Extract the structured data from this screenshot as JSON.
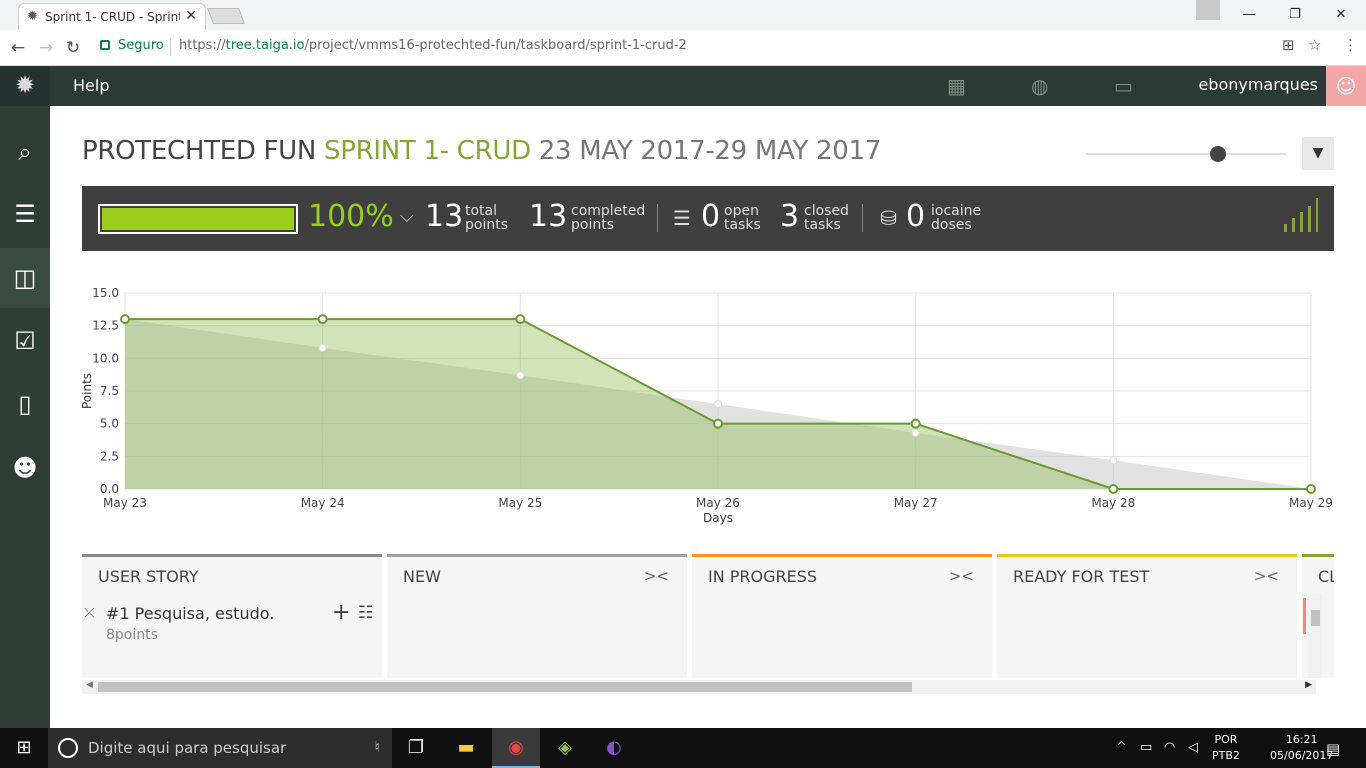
{
  "browser": {
    "tab_title": "Sprint 1- CRUD - Sprint t",
    "tab_close": "✕",
    "window_controls": [
      "—",
      "❐",
      "✕"
    ],
    "secure_label": "Seguro",
    "url_scheme": "https://",
    "url_host": "tree.taiga.io",
    "url_path": "/project/vmms16-protechted-fun/taskboard/sprint-1-crud-2"
  },
  "topnav": {
    "help_label": "Help",
    "username": "ebonymarques"
  },
  "heading": {
    "project": "PROTECHTED FUN",
    "sprint": "SPRINT 1- CRUD",
    "dates": "23 MAY 2017-29 MAY 2017"
  },
  "stats": {
    "progress_percent": 100,
    "percent_label": "100%",
    "total_points": "13",
    "total_points_label_1": "total",
    "total_points_label_2": "points",
    "completed_points": "13",
    "completed_label_1": "completed",
    "completed_label_2": "points",
    "open_tasks": "0",
    "open_label_1": "open",
    "open_label_2": "tasks",
    "closed_tasks": "3",
    "closed_label_1": "closed",
    "closed_label_2": "tasks",
    "iocaine": "0",
    "iocaine_label_1": "iocaine",
    "iocaine_label_2": "doses",
    "accent_color": "#9ccc1c"
  },
  "chart_data": {
    "type": "area",
    "categories": [
      "May 23",
      "May 24",
      "May 25",
      "May 26",
      "May 27",
      "May 28",
      "May 29"
    ],
    "series": [
      {
        "values": [
          13,
          10.8,
          8.7,
          6.5,
          4.3,
          2.2,
          0
        ],
        "color": "#c8c8c8"
      },
      {
        "values": [
          13,
          13,
          13,
          5,
          5,
          0,
          0
        ],
        "color": "#6b9a2e"
      }
    ],
    "xlabel": "Days",
    "ylabel": "Points",
    "ylim": [
      0,
      15
    ],
    "yticks": [
      "0.0",
      "2.5",
      "5.0",
      "7.5",
      "10.0",
      "12.5",
      "15.0"
    ],
    "grid": true
  },
  "board": {
    "columns": [
      {
        "title": "USER STORY",
        "color": "#888888"
      },
      {
        "title": "NEW",
        "color": "#a0a0a0"
      },
      {
        "title": "IN PROGRESS",
        "color": "#f39c12"
      },
      {
        "title": "READY FOR TEST",
        "color": "#f1c40f"
      },
      {
        "title": "CL",
        "color": "#83a636"
      }
    ],
    "fold_label": "><",
    "story": {
      "title": "#1 Pesquisa, estudo.",
      "points_value": "8",
      "points_unit": "points"
    }
  },
  "taskbar": {
    "search_placeholder": "Digite aqui para pesquisar",
    "lang_1": "POR",
    "lang_2": "PTB2",
    "time": "16:21",
    "date": "05/06/2017"
  }
}
